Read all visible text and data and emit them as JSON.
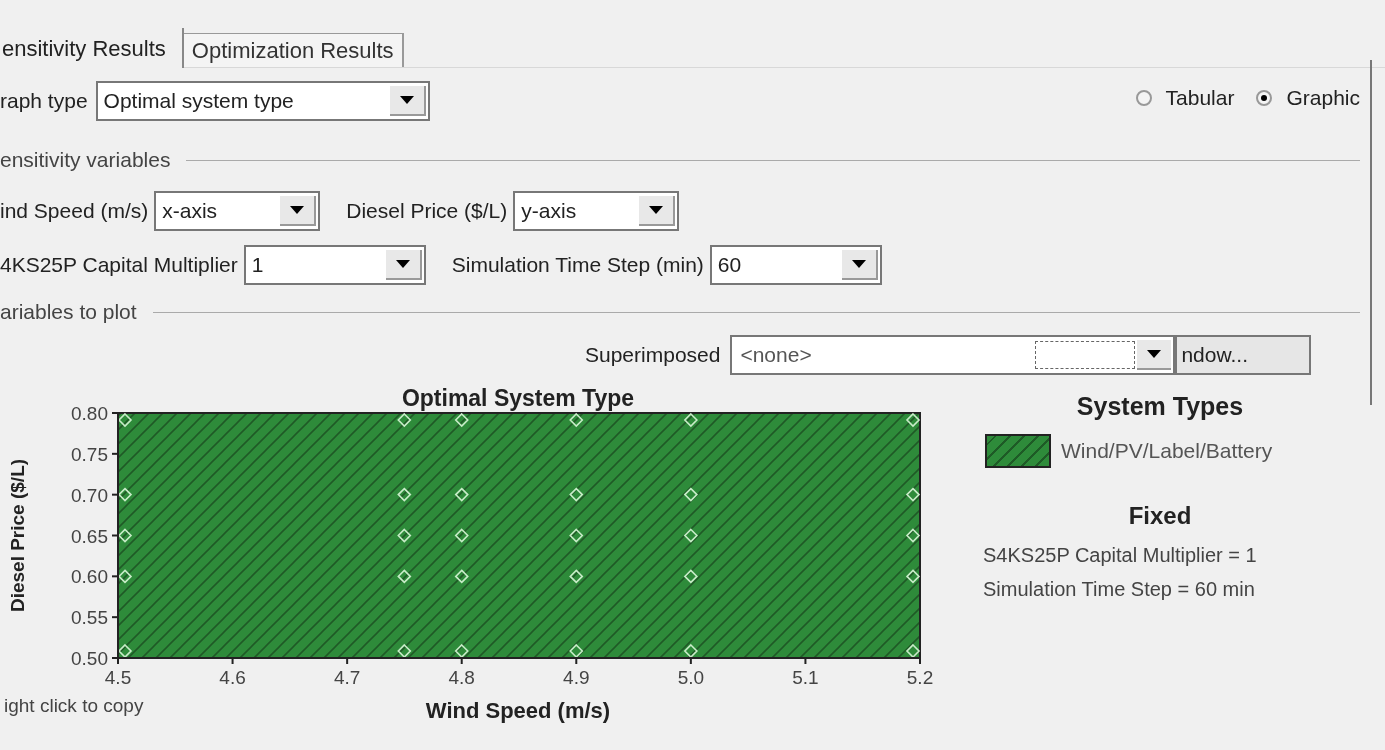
{
  "tabs": [
    {
      "label": "ensitivity Results",
      "selected": true
    },
    {
      "label": "Optimization Results",
      "selected": false
    }
  ],
  "graph_type": {
    "label": "raph type",
    "value": "Optimal system type"
  },
  "view_mode": [
    {
      "label": "Tabular",
      "selected": false
    },
    {
      "label": "Graphic",
      "selected": true
    }
  ],
  "sensitivity_variables": {
    "heading": "ensitivity variables",
    "rows": [
      [
        {
          "label": "ind Speed (m/s)",
          "value": "x-axis"
        },
        {
          "label": "Diesel Price ($/L)",
          "value": "y-axis"
        }
      ],
      [
        {
          "label": "4KS25P Capital Multiplier",
          "value": "1"
        },
        {
          "label": "Simulation Time Step (min)",
          "value": "60"
        }
      ]
    ]
  },
  "variables_to_plot": {
    "heading": "ariables to plot",
    "superimposed_label": "Superimposed",
    "superimposed_value": "<none>",
    "button": "ndow..."
  },
  "chart": {
    "title": "Optimal System Type",
    "xlabel": "Wind Speed (m/s)",
    "ylabel": "Diesel Price ($/L)",
    "xticks": [
      "4.5",
      "4.6",
      "4.7",
      "4.8",
      "4.9",
      "5.0",
      "5.1",
      "5.2"
    ],
    "yticks": [
      "0.80",
      "0.75",
      "0.70",
      "0.65",
      "0.60",
      "0.55",
      "0.50"
    ],
    "copy_hint": "ight click to copy"
  },
  "legend": {
    "heading": "System Types",
    "items": [
      {
        "label": "Wind/PV/Label/Battery",
        "color": "#2e8b3a"
      }
    ],
    "fixed_heading": "Fixed",
    "fixed": [
      "S4KS25P Capital Multiplier = 1",
      "Simulation Time Step = 60 min"
    ]
  }
}
